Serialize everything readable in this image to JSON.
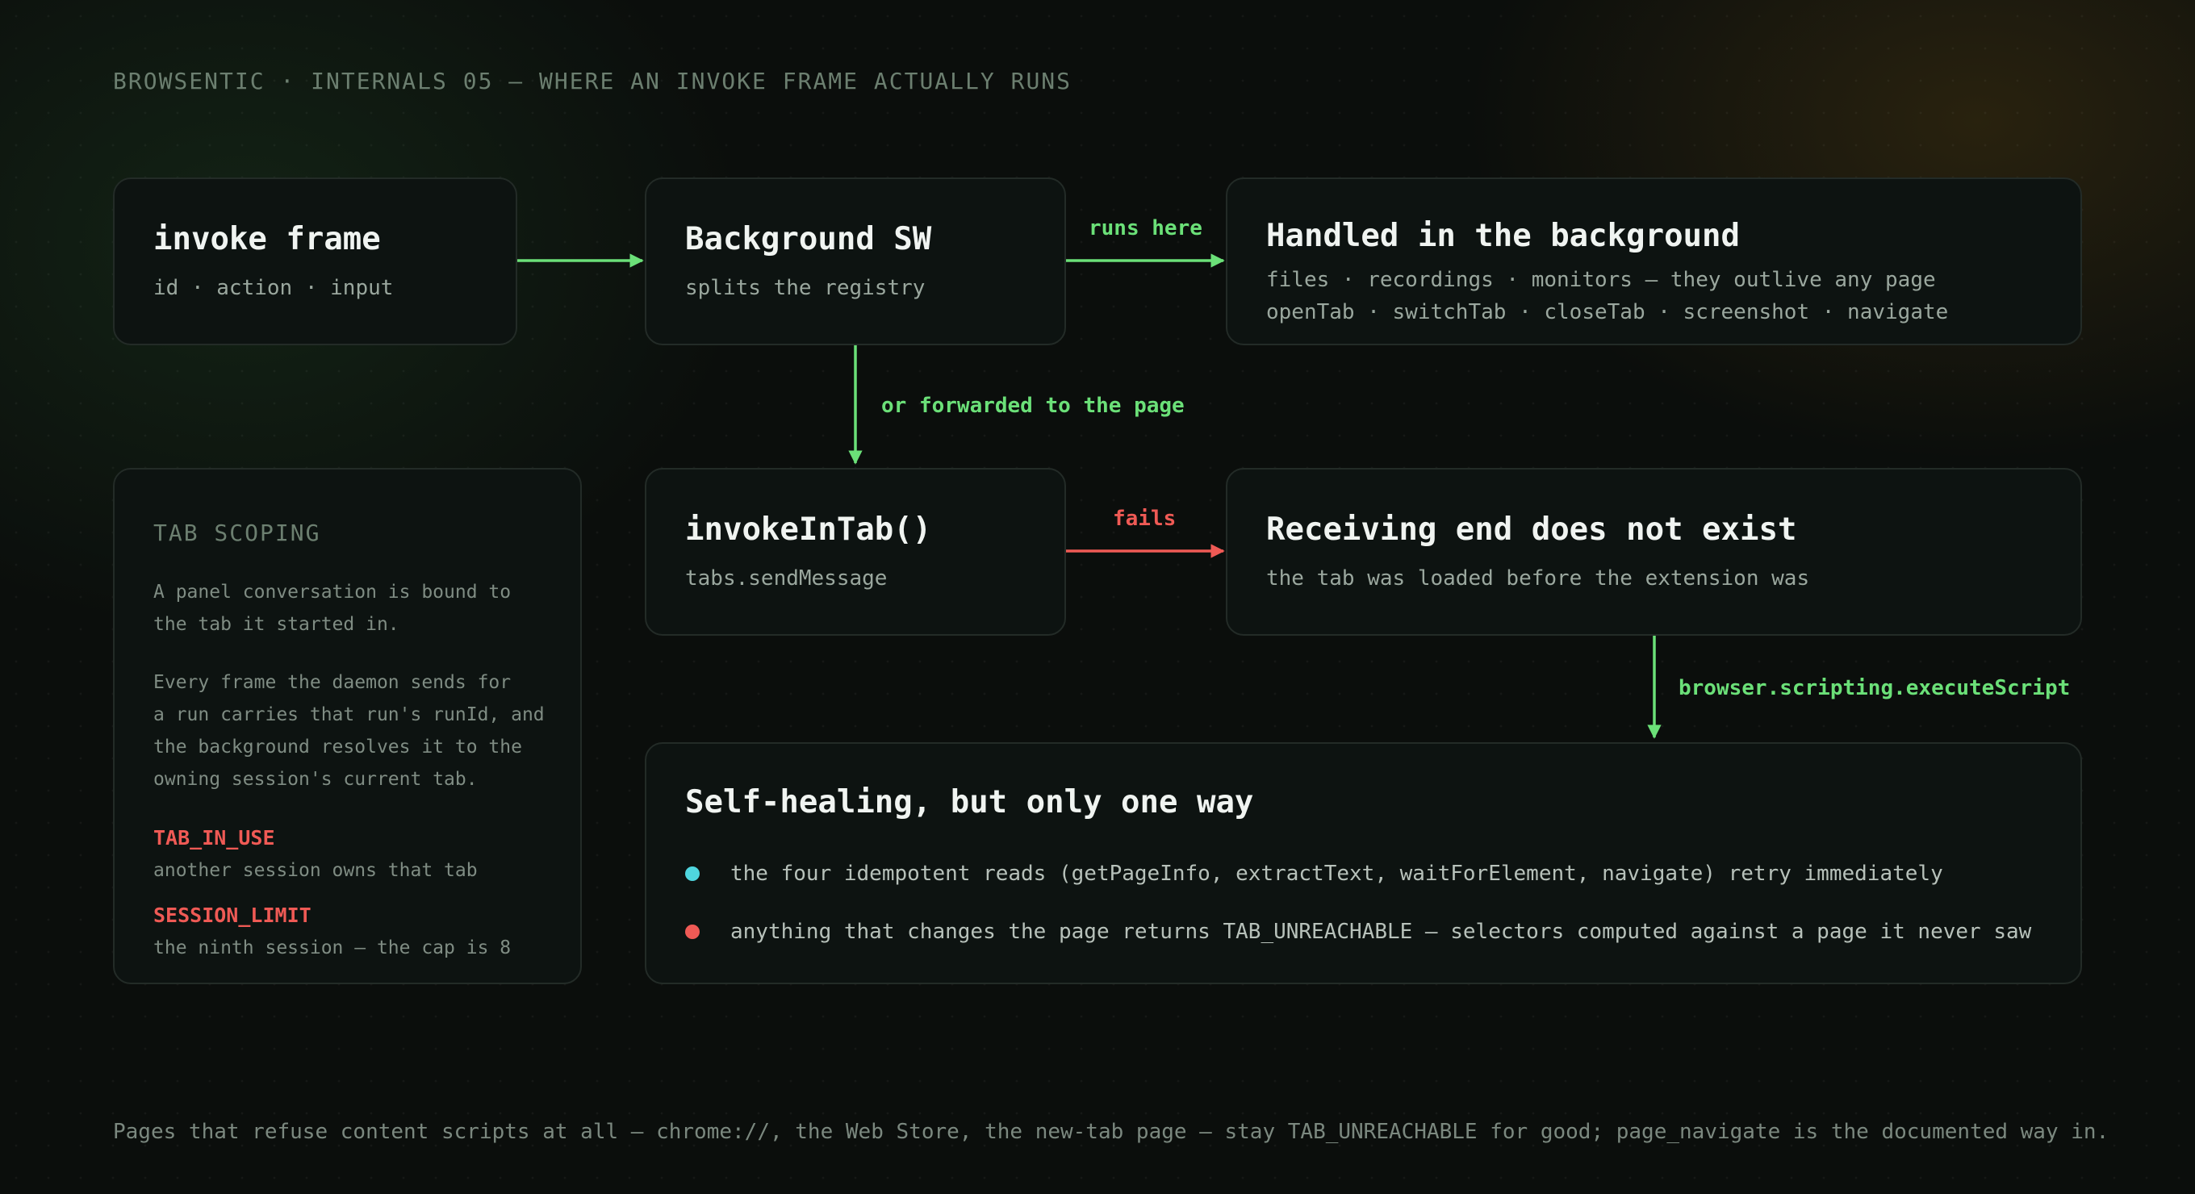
{
  "header": "BROWSENTIC · INTERNALS 05 — WHERE AN INVOKE FRAME ACTUALLY RUNS",
  "nodes": {
    "invoke_frame": {
      "title": "invoke frame",
      "sub": "id · action · input"
    },
    "background_sw": {
      "title": "Background SW",
      "sub": "splits the registry"
    },
    "handled_background": {
      "title": "Handled in the background",
      "line1": "files · recordings · monitors — they outlive any page",
      "line2": "openTab · switchTab · closeTab · screenshot · navigate"
    },
    "invoke_in_tab": {
      "title": "invokeInTab()",
      "sub": "tabs.sendMessage"
    },
    "receiving_end": {
      "title": "Receiving end does not exist",
      "sub": "the tab was loaded before the extension was"
    },
    "self_healing": {
      "title": "Self-healing, but only one way",
      "bullets": [
        {
          "text": "the four idempotent reads (getPageInfo, extractText, waitForElement, navigate) retry immediately",
          "color": "#4fd6df"
        },
        {
          "text": "anything that changes the page returns TAB_UNREACHABLE — selectors computed against a page it never saw",
          "color": "#ef5a55"
        }
      ]
    }
  },
  "edges": {
    "runs_here": "runs here",
    "forwarded": "or forwarded to the page",
    "fails": "fails",
    "execute_script": "browser.scripting.executeScript"
  },
  "tab_scoping": {
    "title": "TAB SCOPING",
    "para1": "A panel conversation is bound to\nthe tab it started in.",
    "para2": "Every frame the daemon sends for\na run carries that run's runId, and\nthe background resolves it to the\nowning session's current tab.",
    "errors": [
      {
        "name": "TAB_IN_USE",
        "desc": "another session owns that tab"
      },
      {
        "name": "SESSION_LIMIT",
        "desc": "the ninth session — the cap is 8"
      }
    ]
  },
  "footer": "Pages that refuse content scripts at all — chrome://, the Web Store, the new-tab page — stay TAB_UNREACHABLE for good; page_navigate is the documented way in.",
  "colors": {
    "accent_green": "#6be078",
    "error_red": "#ef5a55",
    "bullet_cyan": "#4fd6df"
  }
}
